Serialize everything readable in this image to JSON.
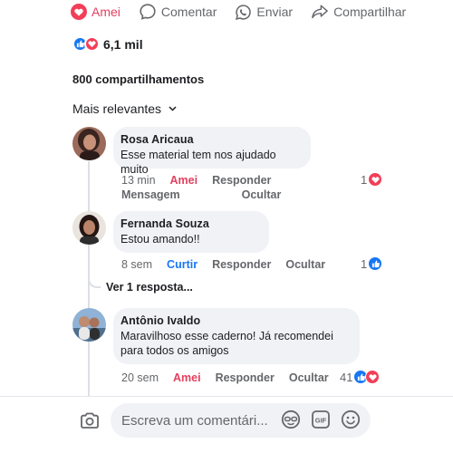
{
  "actions": {
    "like_label": "Amei",
    "comment_label": "Comentar",
    "send_label": "Enviar",
    "share_label": "Compartilhar"
  },
  "reactions": {
    "count": "6,1 mil",
    "types": [
      "like",
      "love"
    ]
  },
  "shares": "800 compartilhamentos",
  "sort": {
    "label": "Mais relevantes"
  },
  "comments": [
    {
      "author": "Rosa Aricaua",
      "text": "Esse material tem nos ajudado muito",
      "time": "13 min",
      "reaction_label": "Amei",
      "reply_label": "Responder",
      "message_label": "Mensagem",
      "hide_label": "Ocultar",
      "count": "1",
      "reaction_types": [
        "love"
      ]
    },
    {
      "author": "Fernanda Souza",
      "text": "Estou amando!!",
      "time": "8 sem",
      "reaction_label": "Curtir",
      "reply_label": "Responder",
      "hide_label": "Ocultar",
      "count": "1",
      "reaction_types": [
        "like"
      ]
    },
    {
      "author": "Antônio Ivaldo",
      "text_line1": "Maravilhoso esse caderno! Já recomendei",
      "text_line2": "para todos os amigos",
      "time": "20 sem",
      "reaction_label": "Amei",
      "reply_label": "Responder",
      "hide_label": "Ocultar",
      "count": "41",
      "reaction_types": [
        "like",
        "love"
      ]
    }
  ],
  "more_replies": "Ver 1 resposta...",
  "composer": {
    "placeholder": "Escreva um comentári..."
  },
  "colors": {
    "love": "#e4405f",
    "like": "#1877f2",
    "bubble": "#f0f2f5",
    "muted": "#65676b"
  }
}
